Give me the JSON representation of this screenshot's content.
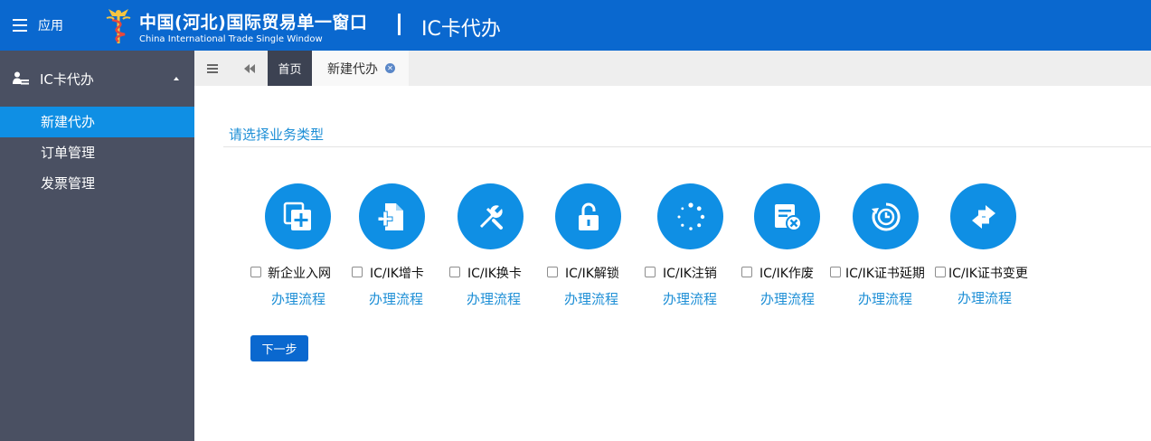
{
  "header": {
    "app_label": "应用",
    "title_cn": "中国(河北)国际贸易单一窗口",
    "title_en": "China International Trade Single Window",
    "module": "IC卡代办"
  },
  "sidebar": {
    "group_label": "IC卡代办",
    "items": [
      {
        "label": "新建代办",
        "active": true
      },
      {
        "label": "订单管理",
        "active": false
      },
      {
        "label": "发票管理",
        "active": false
      }
    ]
  },
  "tabs": {
    "home": "首页",
    "current": "新建代办"
  },
  "main": {
    "section_title": "请选择业务类型",
    "options": [
      {
        "label": "新企业入网",
        "flow": "办理流程",
        "icon": "add-copy-icon"
      },
      {
        "label": "IC/IK增卡",
        "flow": "办理流程",
        "icon": "add-file-icon"
      },
      {
        "label": "IC/IK换卡",
        "flow": "办理流程",
        "icon": "wrench-icon"
      },
      {
        "label": "IC/IK解锁",
        "flow": "办理流程",
        "icon": "unlock-icon"
      },
      {
        "label": "IC/IK注销",
        "flow": "办理流程",
        "icon": "spinner-icon"
      },
      {
        "label": "IC/IK作废",
        "flow": "办理流程",
        "icon": "invalidate-card-icon"
      },
      {
        "label": "IC/IK证书延期",
        "flow": "办理流程",
        "icon": "clock-history-icon"
      },
      {
        "label": "IC/IK证书变更",
        "flow": "办理流程",
        "icon": "exchange-arrows-icon"
      }
    ],
    "next_button": "下一步"
  },
  "colors": {
    "header_bg": "#0a68cf",
    "sidebar_bg": "#4a5062",
    "active_item": "#0f8fe4",
    "accent_text": "#1e8fd6",
    "icon_circle": "#0f8fe4"
  }
}
